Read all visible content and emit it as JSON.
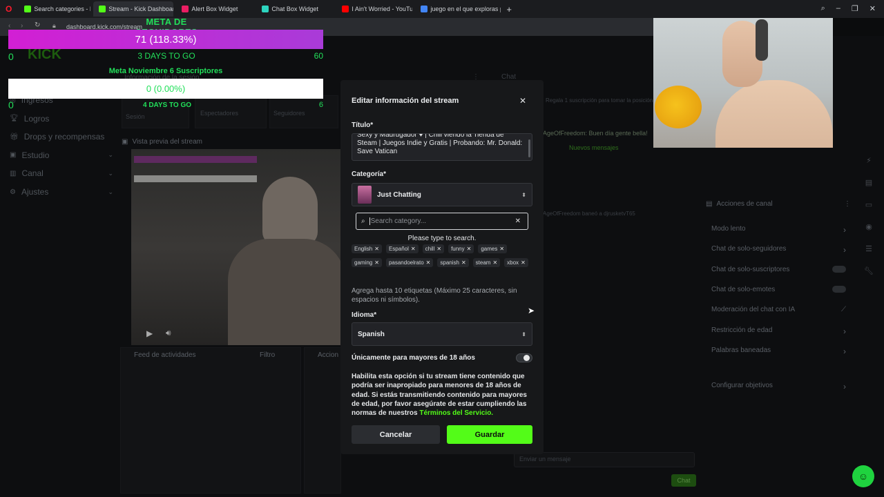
{
  "browser": {
    "tabs": [
      {
        "label": "Search categories - Kick S",
        "active": false,
        "color": "#53fc18"
      },
      {
        "label": "Stream - Kick Dashboard",
        "active": true,
        "color": "#53fc18"
      },
      {
        "label": "Alert Box Widget",
        "active": false,
        "color": "#e91e63"
      },
      {
        "label": "Chat Box Widget",
        "active": false,
        "color": "#2dd4bf"
      },
      {
        "label": "I Ain't Worried - YouTu",
        "active": false,
        "color": "#ff0000"
      },
      {
        "label": "juego en el que exploras p",
        "active": false,
        "color": "#4285f4"
      }
    ],
    "new_tab": "+",
    "url": "dashboard.kick.com/stream"
  },
  "sidebar": {
    "items": [
      {
        "label": "Ingresos",
        "icon": "dollar-icon",
        "chevron": false
      },
      {
        "label": "Logros",
        "icon": "trophy-icon",
        "chevron": false
      },
      {
        "label": "Drops y recompensas",
        "icon": "gift-icon",
        "chevron": false
      },
      {
        "label": "Estudio",
        "icon": "studio-icon",
        "chevron": true
      },
      {
        "label": "Canal",
        "icon": "channel-icon",
        "chevron": true
      },
      {
        "label": "Ajustes",
        "icon": "gear-icon",
        "chevron": true
      }
    ]
  },
  "background": {
    "session_info": "Información de la sesión",
    "session": "Sesión",
    "spectators": "Espectadores",
    "followers": "Seguidores",
    "preview_title": "Vista previa del stream",
    "activity_feed": "Feed de actividades",
    "filter": "Filtro",
    "actions": "Accion",
    "chat": "Chat",
    "chat_new": "Nuevos mensajes",
    "chat_line1": "AgeOfFreedom: Buen día gente bella!",
    "chat_line2": "AgeOfFreedom baneó a djrusketvT65",
    "chat_promo": "Regala 1 suscripción para tomar la posición",
    "chat_input": "Enviar un mensaje",
    "chat_button": "Chat",
    "channel_actions": "Acciones de canal",
    "channel_items": [
      {
        "label": "Modo lento",
        "control": "chevron"
      },
      {
        "label": "Chat de solo-seguidores",
        "control": "chevron"
      },
      {
        "label": "Chat de solo-suscriptores",
        "control": "toggle"
      },
      {
        "label": "Chat de solo-emotes",
        "control": "toggle"
      },
      {
        "label": "Moderación del chat con IA",
        "control": "chart"
      },
      {
        "label": "Restricción de edad",
        "control": "chevron"
      },
      {
        "label": "Palabras baneadas",
        "control": "chevron"
      },
      {
        "label": "Configurar objetivos",
        "control": "chevron"
      }
    ]
  },
  "overlay": {
    "goal1": {
      "title": "META DE SEGUIDORES",
      "bar": "71 (118.33%)",
      "start": "0",
      "days": "3 DAYS TO GO",
      "end": "60",
      "progress": 1.0
    },
    "goal2": {
      "title": "Meta Noviembre 6 Suscriptores",
      "bar": "0 (0.00%)",
      "start": "0",
      "days": "4 DAYS TO GO",
      "end": "6",
      "progress": 0.0
    }
  },
  "modal": {
    "title": "Editar información del stream",
    "title_label": "Título*",
    "title_value": "Sexy y Madrugador ♥ | Chill viendo la Tienda de Steam | Juegos Indie y Gratis | Probando: Mr. Donald: Save Vatican",
    "category_label": "Categoría*",
    "category_value": "Just Chatting",
    "search_placeholder": "Search category...",
    "search_hint": "Please type to search.",
    "tags": [
      "English",
      "Español",
      "chill",
      "funny",
      "games",
      "gaming",
      "pasandoelrato",
      "spanish",
      "steam",
      "xbox"
    ],
    "tags_help": "Agrega hasta 10 etiquetas (Máximo 25 caracteres, sin espacios ni símbolos).",
    "language_label": "Idioma*",
    "language_value": "Spanish",
    "adult_label": "Únicamente para mayores de 18 años",
    "adult_enabled": false,
    "adult_help": "Habilita esta opción si tu stream tiene contenido que podría ser inapropiado para menores de 18 años de edad. Si estás transmitiendo contenido para mayores de edad, por favor asegúrate de estar cumpliendo las normas de nuestros",
    "terms_link": "Términos del Servicio.",
    "cancel": "Cancelar",
    "save": "Guardar"
  },
  "colors": {
    "accent": "#53fc18",
    "goal_green": "#22e05a",
    "goal_magenta": "#d21fd4"
  }
}
